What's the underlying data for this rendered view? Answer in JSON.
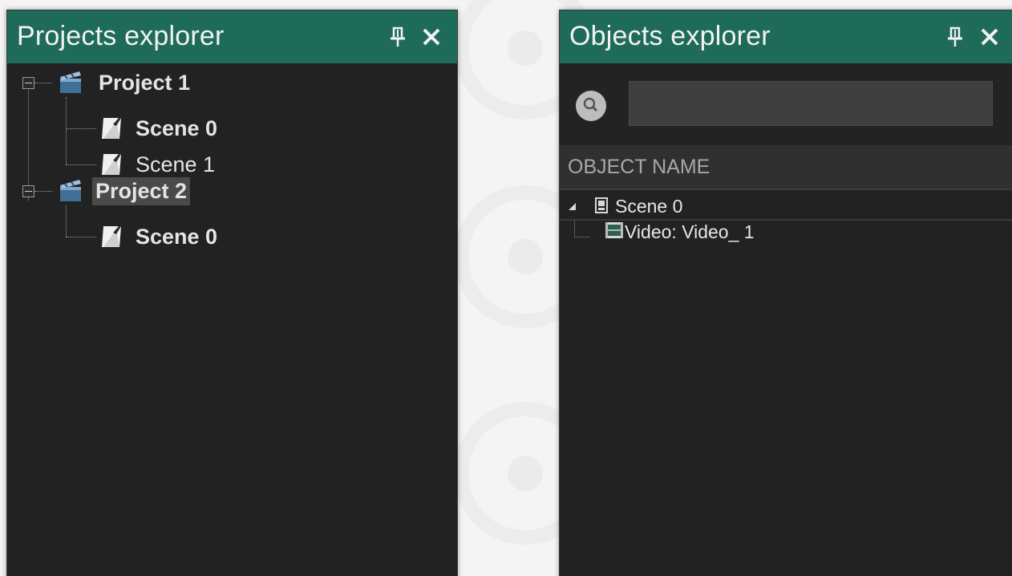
{
  "projects_explorer": {
    "title": "Projects explorer",
    "pin_icon": "pin-icon",
    "close_icon": "close-icon",
    "tree": [
      {
        "label": "Project 1",
        "icon": "clapperboard-icon",
        "bold": true,
        "expanded": true,
        "children": [
          {
            "label": "Scene 0",
            "icon": "scene-icon",
            "bold": true
          },
          {
            "label": "Scene 1",
            "icon": "scene-icon",
            "bold": false
          }
        ]
      },
      {
        "label": "Project 2",
        "icon": "clapperboard-icon",
        "bold": true,
        "expanded": true,
        "selected": true,
        "children": [
          {
            "label": "Scene 0",
            "icon": "scene-icon",
            "bold": true
          }
        ]
      }
    ]
  },
  "objects_explorer": {
    "title": "Objects explorer",
    "pin_icon": "pin-icon",
    "close_icon": "close-icon",
    "search": {
      "icon": "search-icon",
      "value": "",
      "placeholder": ""
    },
    "column_header": "OBJECT NAME",
    "tree": [
      {
        "label": "Scene 0",
        "icon": "device-icon",
        "expanded": true,
        "children": [
          {
            "label": "Video: Video_ 1",
            "icon": "video-icon"
          }
        ]
      }
    ]
  },
  "colors": {
    "titlebar": "#1f6b5a",
    "panel_bg": "#222222",
    "text": "#e4e4e4",
    "page_bg": "#f4f4f4"
  }
}
